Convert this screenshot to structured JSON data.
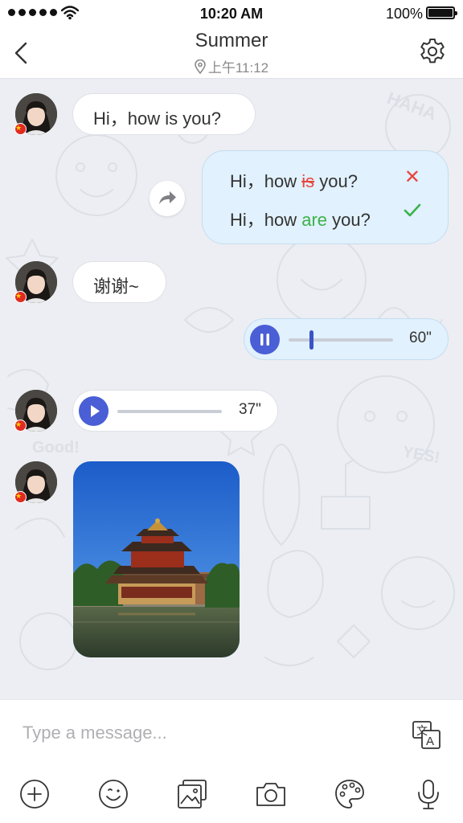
{
  "status_bar": {
    "time": "10:20 AM",
    "battery": "100%"
  },
  "header": {
    "title": "Summer",
    "subtitle": "上午11:12"
  },
  "messages": {
    "m1": {
      "text": "Hi，how is you?"
    },
    "correction": {
      "original_pre": "Hi，how ",
      "original_wrong": "is",
      "original_post": " you?",
      "fixed_pre": "Hi，how ",
      "fixed_right": "are",
      "fixed_post": " you?"
    },
    "m3": {
      "text": "谢谢~"
    },
    "voice_out": {
      "duration": "60\"",
      "progress": 0.2
    },
    "voice_in": {
      "duration": "37\""
    }
  },
  "composer": {
    "placeholder": "Type a message..."
  },
  "icons": {
    "back": "chevron-left-icon",
    "settings": "gear-icon",
    "location": "location-pin-icon",
    "forward": "forward-arrow-icon",
    "translate": "translate-icon",
    "add": "plus-circle-icon",
    "emoji": "emoji-icon",
    "gallery": "gallery-icon",
    "camera": "camera-icon",
    "palette": "palette-icon",
    "microphone": "microphone-icon"
  },
  "colors": {
    "accent": "#4a5ed5",
    "sent_bubble": "#e1f1fd",
    "error": "#e7463f",
    "success": "#3bb24a",
    "chat_bg": "#eceef3"
  }
}
